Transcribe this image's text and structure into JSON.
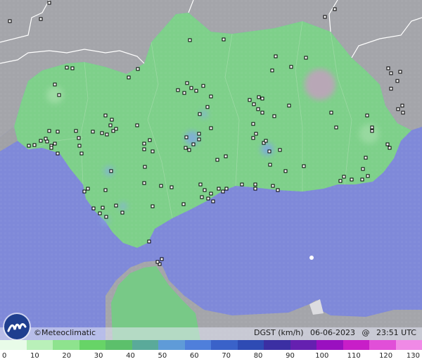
{
  "brand": {
    "copyright": "©",
    "name": "Meteoclimatic"
  },
  "header": {
    "variable": "DGST (km/h)",
    "date": "06-06-2023",
    "at": "@",
    "time": "23:51 UTC"
  },
  "legend": {
    "ticks": [
      "0",
      "10",
      "20",
      "30",
      "40",
      "50",
      "60",
      "70",
      "80",
      "90",
      "100",
      "110",
      "120",
      "130"
    ],
    "colors": [
      "#e8fbe8",
      "#b9f0b9",
      "#8ee38e",
      "#67d467",
      "#5cc06b",
      "#5aaa9a",
      "#5f9bd8",
      "#4f7fdb",
      "#3a62c9",
      "#2e4bb4",
      "#3b2fa3",
      "#6520b0",
      "#9a10c0",
      "#c81ec8",
      "#e14fd8",
      "#f08ae6"
    ]
  },
  "colors": {
    "sea": "#7f89d9",
    "land_calm": "#7ed08a",
    "land_foreign": "#a6a6aa",
    "border": "#ffffff"
  },
  "icons": [
    "meteoclimatic-logo-icon",
    "station-marker-icon"
  ]
}
